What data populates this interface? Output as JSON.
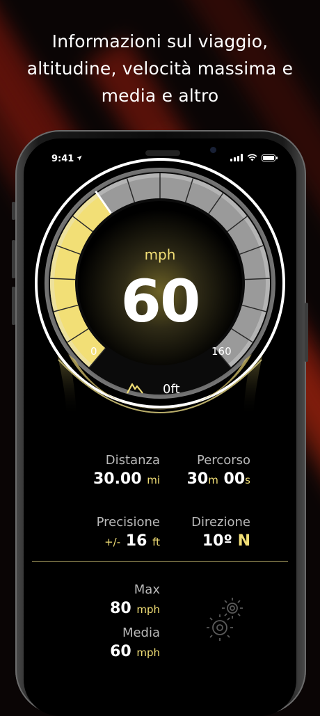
{
  "headline": {
    "line1": "Informazioni sul viaggio,",
    "line2": "altitudine, velocità massima e",
    "line3": "media e altro"
  },
  "status_bar": {
    "time": "9:41",
    "icons": [
      "location-arrow-icon",
      "cellular-signal-icon",
      "wifi-icon",
      "battery-icon"
    ]
  },
  "gauge": {
    "unit": "mph",
    "speed": "60",
    "min_label": "0",
    "max_label": "160",
    "min_value": 0,
    "max_value": 160,
    "current_value": 60,
    "altitude": "0ft",
    "altitude_icon": "mountain-icon"
  },
  "stats": {
    "distance": {
      "label": "Distanza",
      "value": "30.00",
      "unit": "mi"
    },
    "trip": {
      "label": "Percorso",
      "minutes": "30",
      "minutes_unit": "m",
      "seconds": "00",
      "seconds_unit": "s"
    },
    "accuracy": {
      "label": "Precisione",
      "prefix": "+/-",
      "value": "16",
      "unit": "ft"
    },
    "heading": {
      "label": "Direzione",
      "value": "10º",
      "cardinal": "N"
    },
    "max": {
      "label": "Max",
      "value": "80",
      "unit": "mph"
    },
    "average": {
      "label": "Media",
      "value": "60",
      "unit": "mph"
    }
  },
  "settings": {
    "icon": "gears-icon"
  },
  "colors": {
    "accent_yellow": "#f2df76",
    "background": "#000000",
    "label_gray": "#b9b9b9",
    "streak_red": "#8c1a0e"
  }
}
